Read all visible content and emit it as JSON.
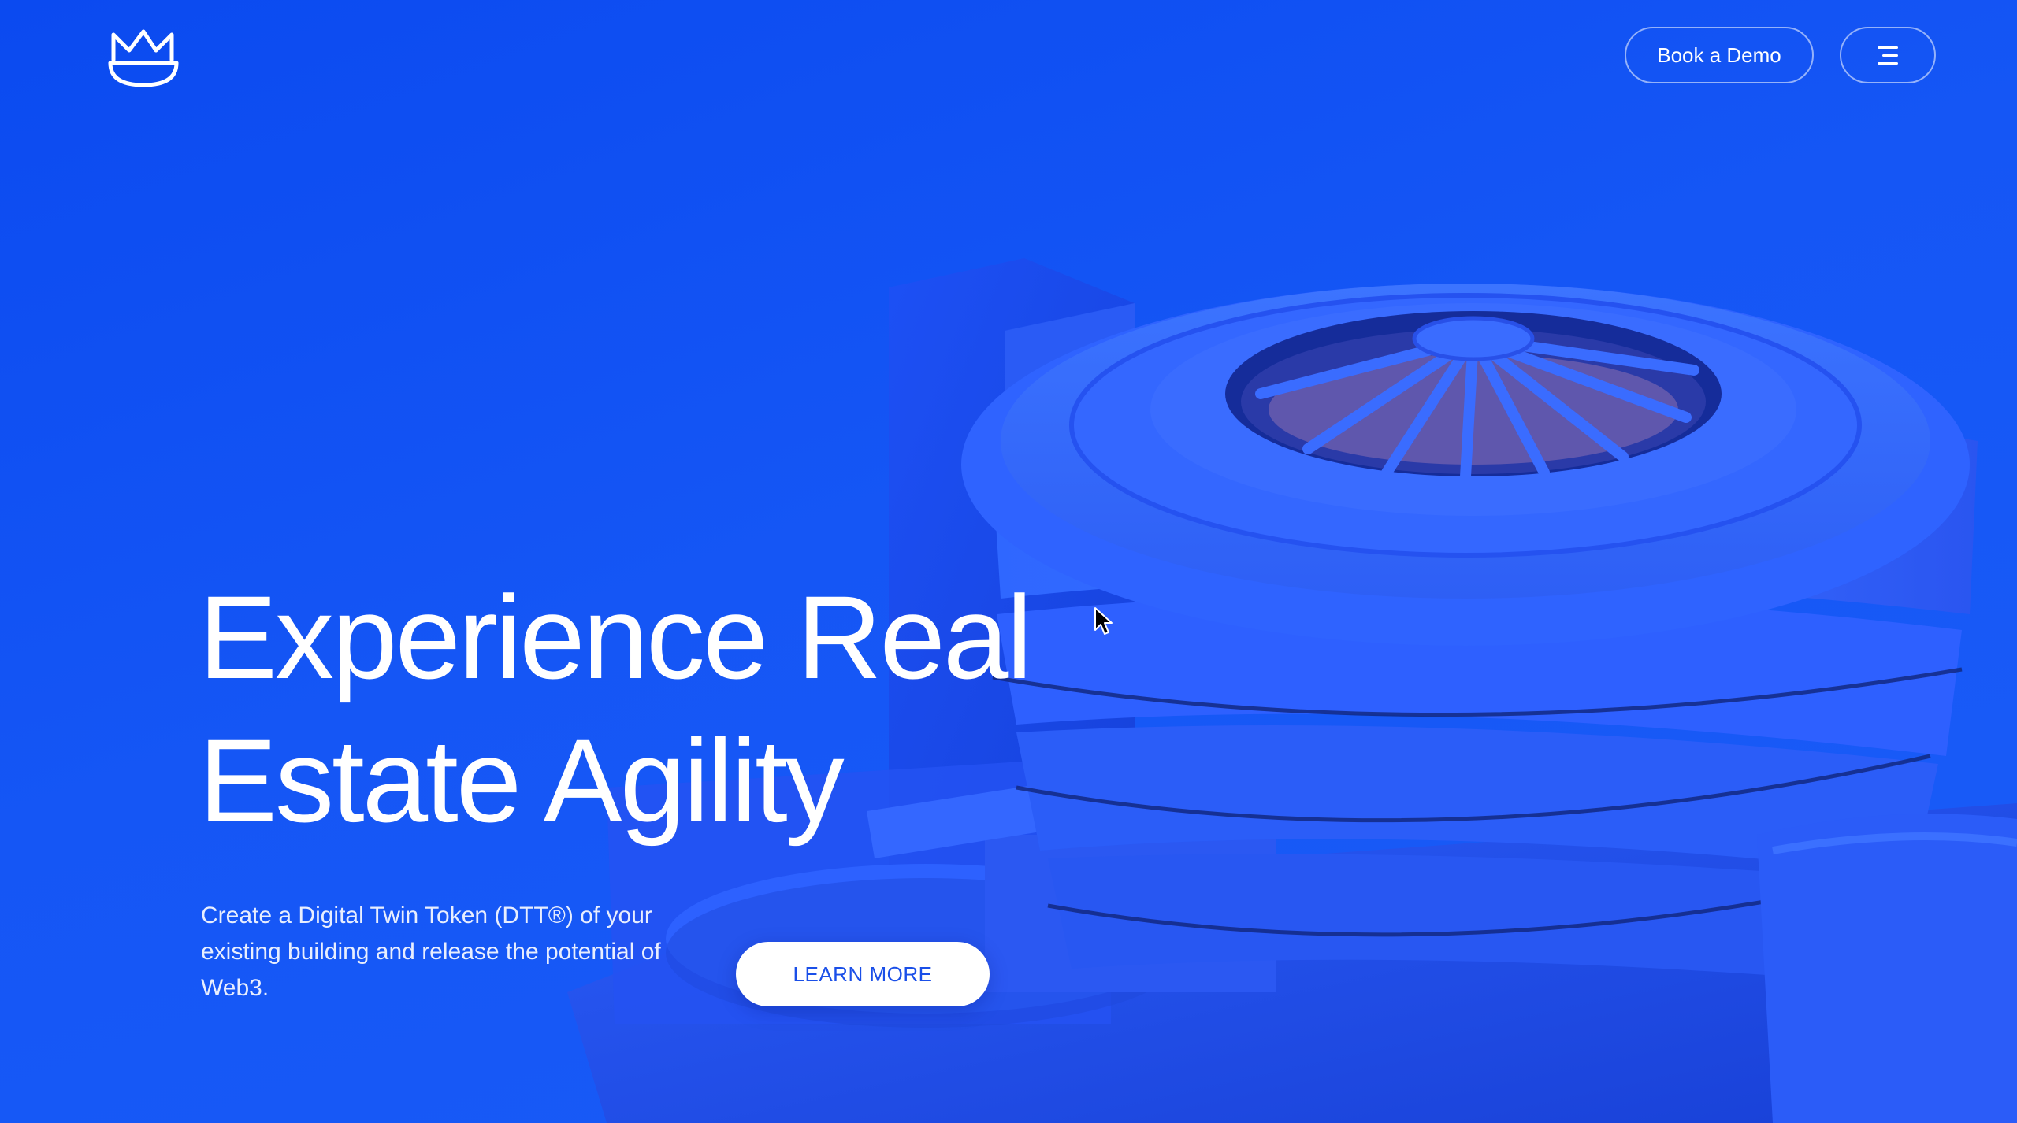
{
  "header": {
    "logo_icon": "cat-m-logo-icon",
    "demo_label": "Book a Demo",
    "menu_icon": "hamburger-menu-icon"
  },
  "hero": {
    "headline_line1": "Experience Real",
    "headline_line2": "Estate Agility",
    "description": "Create a Digital Twin Token (DTT®) of your existing building and release the potential of Web3.",
    "cta_label": "LEARN MORE",
    "illustration_icon": "spiral-museum-building-illustration"
  },
  "colors": {
    "background": "#0b4af0",
    "building": "#2a5dff",
    "cta_text": "#1a4fe8"
  }
}
